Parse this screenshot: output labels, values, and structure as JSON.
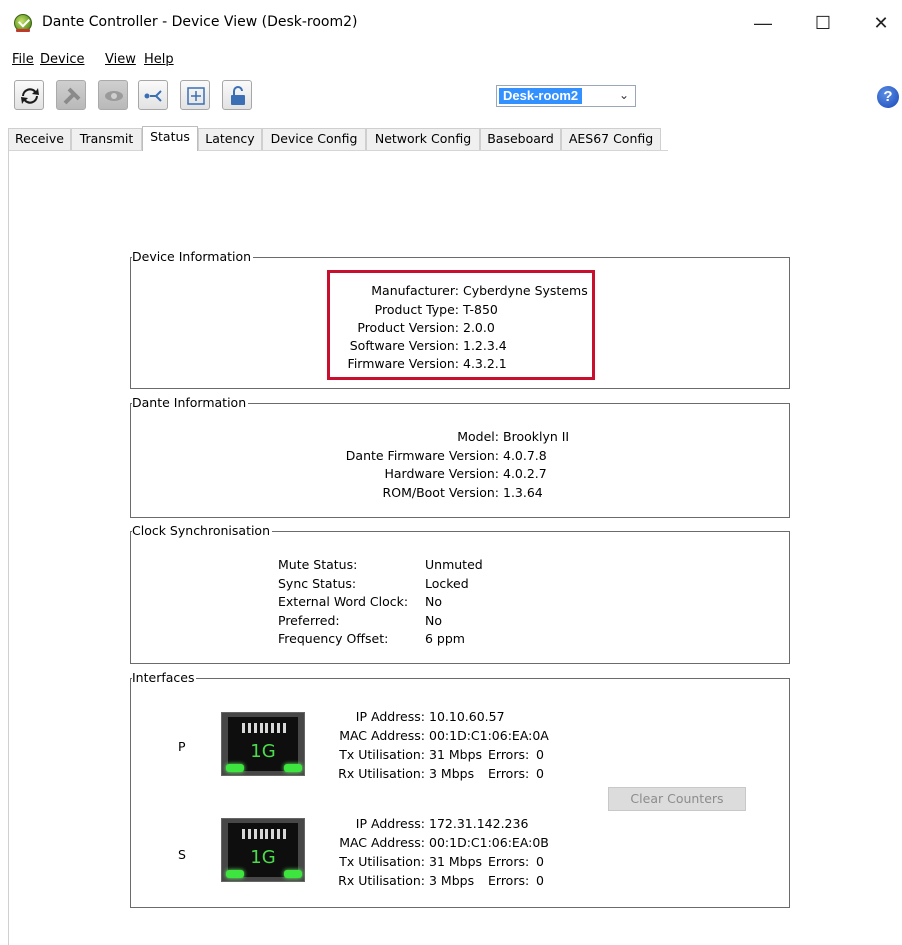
{
  "window": {
    "title": "Dante Controller - Device View (Desk-room2)",
    "minimize": "—",
    "maximize": "☐",
    "close": "✕"
  },
  "menu": [
    "File",
    "Device",
    "View",
    "Help"
  ],
  "toolbar": {
    "device_selected": "Desk-room2",
    "help_symbol": "?",
    "buttons": [
      "refresh-icon",
      "tools-icon",
      "eye-icon",
      "network-icon",
      "add-icon",
      "lock-icon"
    ]
  },
  "tabs": [
    "Receive",
    "Transmit",
    "Status",
    "Latency",
    "Device Config",
    "Network Config",
    "Baseboard",
    "AES67 Config"
  ],
  "active_tab": "Status",
  "device_information": {
    "title": "Device Information",
    "rows": [
      {
        "label": "Manufacturer:",
        "value": "Cyberdyne Systems"
      },
      {
        "label": "Product Type:",
        "value": "T-850"
      },
      {
        "label": "Product Version:",
        "value": "2.0.0"
      },
      {
        "label": "Software Version:",
        "value": "1.2.3.4"
      },
      {
        "label": "Firmware Version:",
        "value": "4.3.2.1"
      }
    ]
  },
  "dante_information": {
    "title": "Dante Information",
    "rows": [
      {
        "label": "Model:",
        "value": "Brooklyn II"
      },
      {
        "label": "Dante Firmware Version:",
        "value": "4.0.7.8"
      },
      {
        "label": "Hardware Version:",
        "value": "4.0.2.7"
      },
      {
        "label": "ROM/Boot Version:",
        "value": "1.3.64"
      }
    ]
  },
  "clock_sync": {
    "title": "Clock Synchronisation",
    "rows": [
      {
        "label": "Mute Status:",
        "value": "Unmuted"
      },
      {
        "label": "Sync Status:",
        "value": "Locked"
      },
      {
        "label": "External Word Clock:",
        "value": "No"
      },
      {
        "label": "Preferred:",
        "value": "No"
      },
      {
        "label": "Frequency Offset:",
        "value": "6 ppm"
      }
    ]
  },
  "interfaces": {
    "title": "Interfaces",
    "clear_counters": "Clear Counters",
    "ports": [
      {
        "name": "P",
        "speed": "1G",
        "ip_label": "IP Address:",
        "ip": "10.10.60.57",
        "mac_label": "MAC Address:",
        "mac": "00:1D:C1:06:EA:0A",
        "tx_label": "Tx Utilisation:",
        "tx": "31 Mbps",
        "tx_err_label": "Errors:",
        "tx_err": "0",
        "rx_label": "Rx Utilisation:",
        "rx": "3 Mbps",
        "rx_err_label": "Errors:",
        "rx_err": "0"
      },
      {
        "name": "S",
        "speed": "1G",
        "ip_label": "IP Address:",
        "ip": "172.31.142.236",
        "mac_label": "MAC Address:",
        "mac": "00:1D:C1:06:EA:0B",
        "tx_label": "Tx Utilisation:",
        "tx": "31 Mbps",
        "tx_err_label": "Errors:",
        "tx_err": "0",
        "rx_label": "Rx Utilisation:",
        "rx": "3 Mbps",
        "rx_err_label": "Errors:",
        "rx_err": "0"
      }
    ]
  },
  "colors": {
    "highlight": "#c8102e",
    "select_highlight": "#3390ff",
    "led": "#3ee53e",
    "port_text": "#4bdc4b"
  }
}
